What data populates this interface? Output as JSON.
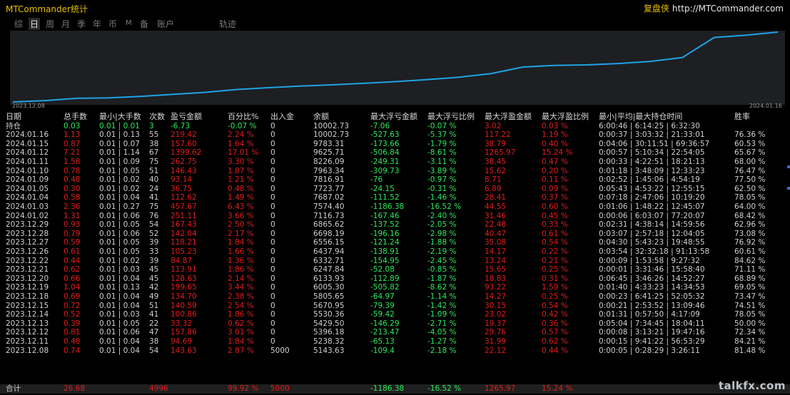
{
  "app_title": "MTCommander统计",
  "brand": {
    "name": "复盘侠",
    "url": "http://MTCommander.com"
  },
  "tabs": [
    "综",
    "日",
    "周",
    "月",
    "季",
    "年",
    "币",
    "M",
    "备",
    "账户",
    "轨迹"
  ],
  "active_tab": 1,
  "chart": {
    "start_date": "2023.12.08",
    "end_date": "2024.01.16",
    "color": "#1fa3e6",
    "balance_series": [
      5143.63,
      5238.32,
      5396.18,
      5429.5,
      5530.36,
      5670.95,
      5805.65,
      6005.3,
      6133.93,
      6247.84,
      6332.71,
      6437.94,
      6556.15,
      6698.19,
      6865.62,
      7116.73,
      7574.4,
      7687.02,
      7723.77,
      7816.91,
      7963.34,
      8226.09,
      9625.71,
      9783.31,
      10002.73
    ]
  },
  "headers": [
    "日期",
    "总手数",
    "最小|大手数",
    "次数",
    "盈亏金额",
    "百分比%",
    "出入金",
    "余额",
    "最大浮亏金额",
    "最大浮亏比例",
    "最大浮盈金额",
    "最大浮盈比例",
    "最小|平均|最大持仓时间",
    "胜率"
  ],
  "holding_row": [
    "持仓",
    "0.03",
    "0.01 | 0.01",
    "3",
    "-6.73",
    "-0.07 %",
    "0",
    "10002.73",
    "-7.06",
    "-0.07 %",
    "3.02",
    "0.03 %",
    "6:00:46 | 6:14:25 | 6:32:30",
    ""
  ],
  "rows": [
    [
      "2024.01.16",
      "1.13",
      "0.01 | 0.13",
      "55",
      "219.42",
      "2.24 %",
      "0",
      "10002.73",
      "-527.63",
      "-5.37 %",
      "117.22",
      "1.19 %",
      "0:00:37 | 3:03:32 | 21:33:01",
      "76.36 %"
    ],
    [
      "2024.01.15",
      "0.87",
      "0.01 | 0.07",
      "38",
      "157.60",
      "1.64 %",
      "0",
      "9783.31",
      "-173.66",
      "-1.79 %",
      "38.79",
      "0.40 %",
      "0:04:06 | 30:11:51 | 69:36:57",
      "60.53 %"
    ],
    [
      "2024.01.12",
      "7.21",
      "0.01 | 1.14",
      "67",
      "1399.62",
      "17.01 %",
      "0",
      "9625.71",
      "-506.84",
      "-8.61 %",
      "1265.97",
      "15.24 %",
      "0:00:57 | 5:10:34 | 22:54:05",
      "65.67 %"
    ],
    [
      "2024.01.11",
      "1.58",
      "0.01 | 0.09",
      "75",
      "262.75",
      "3.30 %",
      "0",
      "8226.09",
      "-249.31",
      "-3.11 %",
      "38.45",
      "0.47 %",
      "0:00:33 | 4:22:51 | 18:21:13",
      "68.00 %"
    ],
    [
      "2024.01.10",
      "0.78",
      "0.01 | 0.05",
      "51",
      "146.43",
      "1.87 %",
      "0",
      "7963.34",
      "-309.73",
      "-3.89 %",
      "15.62",
      "0.20 %",
      "0:01:18 | 3:48:09 | 12:33:23",
      "76.47 %"
    ],
    [
      "2024.01.09",
      "0.48",
      "0.01 | 0.02",
      "40",
      "93.14",
      "1.21 %",
      "0",
      "7816.91",
      "-76",
      "-0.97 %",
      "8.71",
      "0.11 %",
      "0:02:52 | 1:45:06 | 4:54:19",
      "77.50 %"
    ],
    [
      "2024.01.05",
      "0.30",
      "0.01 | 0.02",
      "24",
      "36.75",
      "0.48 %",
      "0",
      "7723.77",
      "-24.15",
      "-0.31 %",
      "6.89",
      "0.09 %",
      "0:05:43 | 4:53:22 | 12:55:15",
      "62.50 %"
    ],
    [
      "2024.01.04",
      "0.58",
      "0.01 | 0.04",
      "41",
      "112.62",
      "1.49 %",
      "0",
      "7687.02",
      "-111.52",
      "-1.46 %",
      "28.41",
      "0.37 %",
      "0:07:18 | 2:47:06 | 10:19:20",
      "78.05 %"
    ],
    [
      "2024.01.03",
      "2.36",
      "0.01 | 0.27",
      "75",
      "457.67",
      "6.43 %",
      "0",
      "7574.40",
      "-1186.38",
      "-16.52 %",
      "44.55",
      "0.60 %",
      "0:01:06 | 1:48:22 | 12:45:07",
      "64.00 %"
    ],
    [
      "2024.01.02",
      "1.31",
      "0.01 | 0.06",
      "76",
      "251.11",
      "3.66 %",
      "0",
      "7116.73",
      "-167.46",
      "-2.40 %",
      "31.46",
      "0.45 %",
      "0:00:06 | 6:03:07 | 77:20:07",
      "68.42 %"
    ],
    [
      "2023.12.29",
      "0.93",
      "0.01 | 0.05",
      "54",
      "167.43",
      "2.50 %",
      "0",
      "6865.62",
      "-137.52",
      "-2.05 %",
      "22.48",
      "0.33 %",
      "0:02:31 | 4:38:14 | 14:59:56",
      "62.96 %"
    ],
    [
      "2023.12.28",
      "0.79",
      "0.01 | 0.06",
      "52",
      "142.04",
      "2.17 %",
      "0",
      "6698.19",
      "-196.16",
      "-2.98 %",
      "40.47",
      "0.61 %",
      "0:03:07 | 2:57:18 | 12:04:05",
      "73.08 %"
    ],
    [
      "2023.12.27",
      "0.59",
      "0.01 | 0.05",
      "39",
      "118.21",
      "1.84 %",
      "0",
      "6556.15",
      "-121.24",
      "-1.88 %",
      "35.08",
      "0.54 %",
      "0:04:30 | 5:43:23 | 19:48:55",
      "76.92 %"
    ],
    [
      "2023.12.26",
      "0.61",
      "0.01 | 0.05",
      "33",
      "105.23",
      "1.66 %",
      "0",
      "6437.94",
      "-138.91",
      "-2.19 %",
      "14.17",
      "0.22 %",
      "0:03:54 | 32:32:18 | 91:13:58",
      "60.61 %"
    ],
    [
      "2023.12.22",
      "0.44",
      "0.01 | 0.02",
      "39",
      "84.87",
      "1.36 %",
      "0",
      "6332.71",
      "-154.95",
      "-2.45 %",
      "13.24",
      "0.21 %",
      "0:00:09 | 1:53:58 | 9:27:32",
      "84.62 %"
    ],
    [
      "2023.12.21",
      "0.62",
      "0.01 | 0.03",
      "45",
      "113.91",
      "1.86 %",
      "0",
      "6247.84",
      "-52.08",
      "-0.85 %",
      "15.65",
      "0.25 %",
      "0:00:01 | 3:31:46 | 15:58:40",
      "71.11 %"
    ],
    [
      "2023.12.20",
      "0.66",
      "0.01 | 0.04",
      "45",
      "128.63",
      "2.14 %",
      "0",
      "6133.93",
      "-112.89",
      "-1.87 %",
      "18.83",
      "0.31 %",
      "0:06:45 | 3:46:26 | 14:52:27",
      "68.89 %"
    ],
    [
      "2023.12.19",
      "1.04",
      "0.01 | 0.13",
      "42",
      "199.65",
      "3.44 %",
      "0",
      "6005.30",
      "-505.82",
      "-8.62 %",
      "93.22",
      "1.59 %",
      "0:01:40 | 4:33:23 | 14:34:53",
      "69.05 %"
    ],
    [
      "2023.12.18",
      "0.69",
      "0.01 | 0.04",
      "49",
      "134.70",
      "2.38 %",
      "0",
      "5805.65",
      "-64.97",
      "-1.14 %",
      "14.27",
      "0.25 %",
      "0:00:23 | 6:41:25 | 52:05:32",
      "73.47 %"
    ],
    [
      "2023.12.15",
      "0.72",
      "0.01 | 0.04",
      "51",
      "140.59",
      "2.54 %",
      "0",
      "5670.95",
      "-79.39",
      "-1.42 %",
      "30.15",
      "0.54 %",
      "0:00:21 | 2:53:52 | 13:09:46",
      "74.51 %"
    ],
    [
      "2023.12.14",
      "0.52",
      "0.01 | 0.03",
      "41",
      "100.86",
      "1.86 %",
      "0",
      "5530.36",
      "-59.42",
      "-1.09 %",
      "23.02",
      "0.42 %",
      "0:01:31 | 0:57:50 | 4:17:09",
      "78.05 %"
    ],
    [
      "2023.12.13",
      "0.39",
      "0.01 | 0.05",
      "22",
      "33.32",
      "0.62 %",
      "0",
      "5429.50",
      "-146.29",
      "-2.71 %",
      "19.37",
      "0.36 %",
      "0:05:04 | 7:34:45 | 18:04:11",
      "50.00 %"
    ],
    [
      "2023.12.12",
      "0.81",
      "0.01 | 0.06",
      "47",
      "157.86",
      "3.01 %",
      "0",
      "5396.18",
      "-213.47",
      "-4.05 %",
      "29.76",
      "0.57 %",
      "0:00:08 | 3:13:21 | 19:47:16",
      "72.34 %"
    ],
    [
      "2023.12.11",
      "0.48",
      "0.01 | 0.04",
      "38",
      "94.69",
      "1.84 %",
      "0",
      "5238.32",
      "-65.13",
      "-1.27 %",
      "31.99",
      "0.62 %",
      "0:00:15 | 9:41:22 | 56:53:29",
      "84.21 %"
    ],
    [
      "2023.12.08",
      "0.74",
      "0.01 | 0.04",
      "54",
      "143.63",
      "2.87 %",
      "5000",
      "5143.63",
      "-109.4",
      "-2.18 %",
      "22.12",
      "0.44 %",
      "0:00:05 | 0:28:29 | 3:26:11",
      "81.48 %"
    ]
  ],
  "total_row": [
    "合计",
    "26.68",
    "",
    "4996",
    "",
    "99.92 %",
    "5000",
    "",
    "-1186.38",
    "-16.52 %",
    "1265.97",
    "15.24 %",
    "",
    ""
  ],
  "watermark": "talkfx.com",
  "colors": {
    "profit": "#e21c1c",
    "loss": "#2ee85c",
    "neutral": "#d0d0d0",
    "title": "#e8c000",
    "line": "#1fa3e6"
  }
}
